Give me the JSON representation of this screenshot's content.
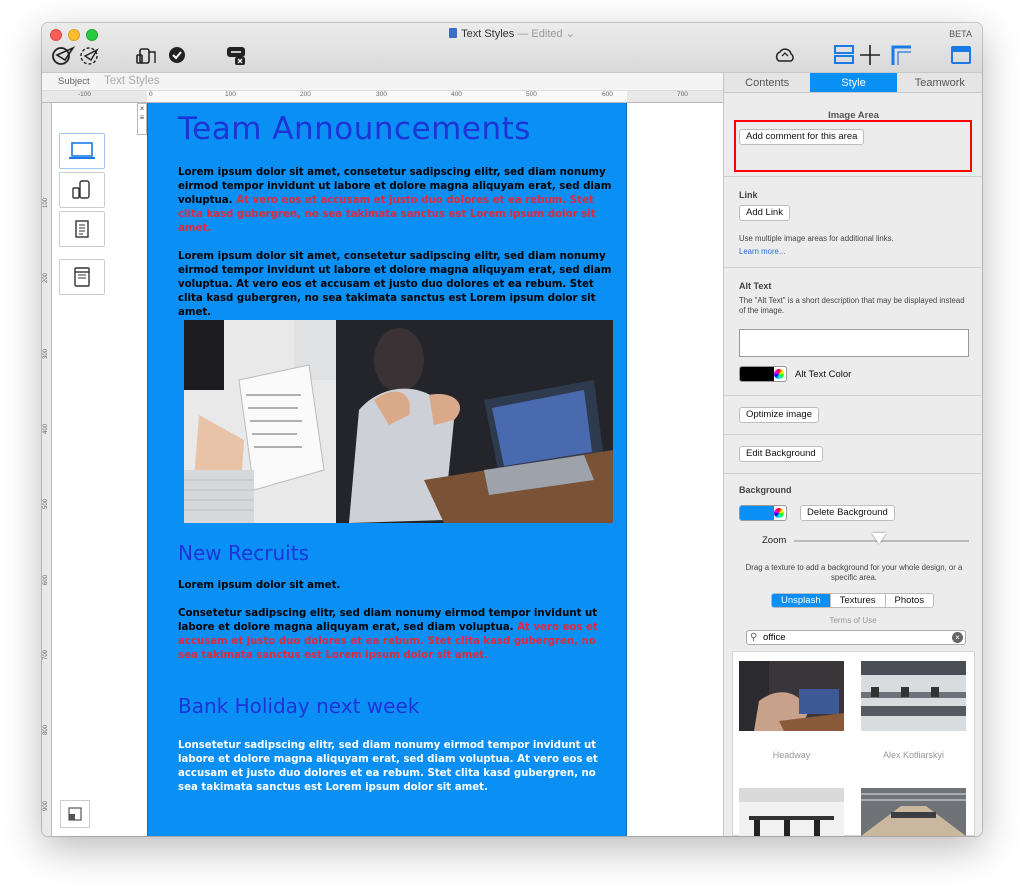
{
  "window": {
    "title": "Text Styles",
    "status": "— Edited",
    "badge": "BETA"
  },
  "subject": {
    "label": "Subject",
    "value": "Text Styles"
  },
  "ruler": {
    "labels": [
      "-100",
      "0",
      "100",
      "200",
      "300",
      "400",
      "500",
      "600",
      "700"
    ],
    "vlabels": [
      "100",
      "200",
      "300",
      "400",
      "500",
      "600",
      "700",
      "800",
      "900"
    ]
  },
  "canvas": {
    "heading": "Team Announcements",
    "p1_black": "Lorem ipsum dolor sit amet, consetetur sadipscing elitr, sed diam nonumy eirmod tempor invidunt ut labore et dolore magna aliquyam erat, sed diam voluptua.",
    "p1_red": " At vero eos et accusam et justo duo dolores et ea rebum. Stet clita kasd gubergren, no sea takimata sanctus est Lorem ipsum dolor sit amet.",
    "p2": "Lorem ipsum dolor sit amet, consetetur sadipscing elitr, sed diam nonumy eirmod tempor invidunt ut labore et dolore magna aliquyam erat, sed diam voluptua. At vero eos et accusam et justo duo dolores et ea rebum. Stet clita kasd gubergren, no sea takimata sanctus est Lorem ipsum dolor sit amet.",
    "h2_recruits": "New Recruits",
    "recruits_line": "Lorem ipsum dolor sit amet.",
    "recruits_black": "Consetetur sadipscing elitr, sed diam nonumy eirmod tempor invidunt ut labore et dolore magna aliquyam erat, sed diam voluptua.",
    "recruits_red": " At vero eos et accusam et justo duo dolores et ea rebum. Stet clita kasd gubergren, no sea takimata sanctus est Lorem ipsum dolor sit amet.",
    "h2_holiday": "Bank Holiday  next week",
    "holiday_text": "Lonsetetur sadipscing elitr, sed diam nonumy eirmod tempor invidunt ut labore et dolore magna aliquyam erat, sed diam voluptua. At vero eos et accusam et justo duo dolores et ea rebum. Stet clita kasd gubergren, no sea takimata sanctus est Lorem ipsum dolor sit amet."
  },
  "sidebar": {
    "tabs": [
      {
        "label": "Contents",
        "active": false
      },
      {
        "label": "Style",
        "active": true
      },
      {
        "label": "Teamwork",
        "active": false
      }
    ],
    "image_area": {
      "title": "Image Area",
      "button": "Add comment for this area"
    },
    "link": {
      "title": "Link",
      "button": "Add Link",
      "note": "Use multiple image areas for additional links.",
      "learn_more": "Learn more..."
    },
    "alt_text": {
      "title": "Alt Text",
      "description": "The \"Alt Text\" is a short description that may be displayed instead of the image.",
      "value": "",
      "color_label": "Alt Text Color",
      "color": "#000000"
    },
    "optimize_button": "Optimize image",
    "edit_background_button": "Edit Background",
    "background": {
      "title": "Background",
      "color": "#0a90f4",
      "delete_button": "Delete Background",
      "zoom_label": "Zoom",
      "zoom_level": 0.7,
      "hint": "Drag a texture to add a background for your whole design, or a specific area.",
      "sources": [
        "Unsplash",
        "Textures",
        "Photos"
      ],
      "active_source": "Unsplash",
      "terms": "Terms of Use",
      "search_value": "office",
      "results": [
        {
          "credit": "Headway"
        },
        {
          "credit": "Alex Kotliarskyi"
        }
      ]
    }
  },
  "colors": {
    "accent": "#0a90f4",
    "heading": "#1d34d6",
    "highlight": "#ff0000",
    "emphasis": "#e3283a"
  }
}
